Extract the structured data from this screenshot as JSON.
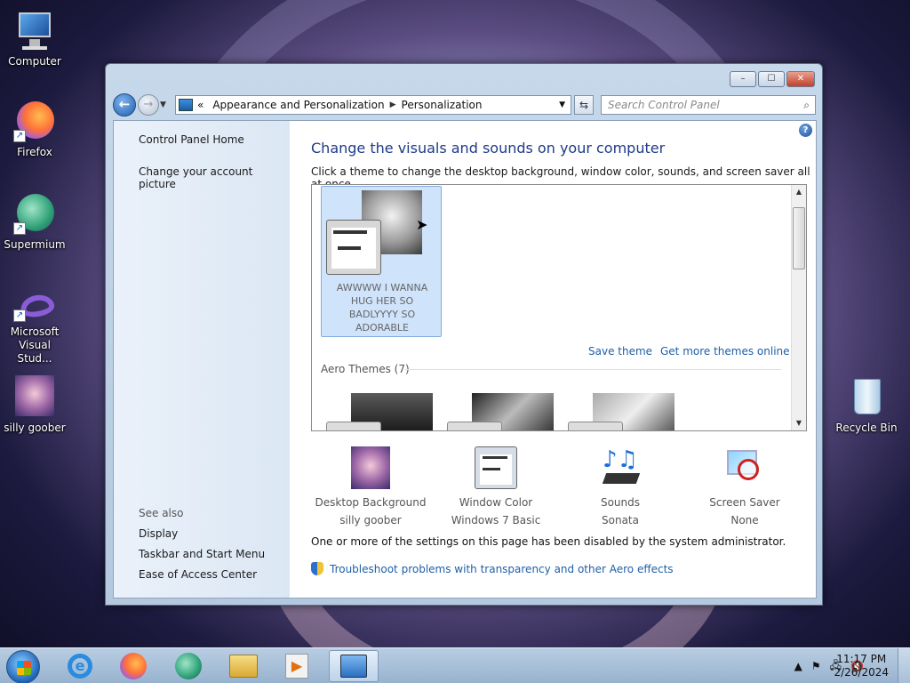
{
  "desktop": {
    "icons": [
      {
        "label": "Computer",
        "icon": "computer-icon"
      },
      {
        "label": "Firefox",
        "icon": "firefox-icon"
      },
      {
        "label": "Supermium",
        "icon": "supermium-icon"
      },
      {
        "label": "Microsoft Visual Stud...",
        "icon": "visual-studio-icon"
      },
      {
        "label": "silly goober",
        "icon": "image-file-icon"
      },
      {
        "label": "Recycle Bin",
        "icon": "recycle-bin-icon"
      }
    ]
  },
  "window": {
    "controls": {
      "minimize": "–",
      "maximize": "☐",
      "close": "✕"
    },
    "address": {
      "prefix": "«",
      "crumbs": [
        "Appearance and Personalization",
        "Personalization"
      ]
    },
    "search_placeholder": "Search Control Panel",
    "help_glyph": "?"
  },
  "sidebar": {
    "links": [
      "Control Panel Home",
      "Change your account picture"
    ],
    "see_also_label": "See also",
    "see_also": [
      "Display",
      "Taskbar and Start Menu",
      "Ease of Access Center"
    ]
  },
  "main": {
    "title": "Change the visuals and sounds on your computer",
    "subtitle": "Click a theme to change the desktop background, window color, sounds, and screen saver all at once.",
    "selected_theme_name": "AWWWW I WANNA HUG HER SO BADLYYYY SO ADORABLE",
    "save_theme": "Save theme",
    "get_more": "Get more themes online",
    "aero_label": "Aero Themes (7)",
    "settings": [
      {
        "label": "Desktop Background",
        "value": "silly goober"
      },
      {
        "label": "Window Color",
        "value": "Windows 7 Basic"
      },
      {
        "label": "Sounds",
        "value": "Sonata"
      },
      {
        "label": "Screen Saver",
        "value": "None"
      }
    ],
    "disabled_message": "One or more of the settings on this page has been disabled by the system administrator.",
    "troubleshoot": "Troubleshoot problems with transparency and other Aero effects"
  },
  "taskbar": {
    "pinned": [
      "internet-explorer-icon",
      "firefox-icon",
      "supermium-icon",
      "windows-explorer-icon",
      "media-player-icon",
      "control-panel-icon"
    ],
    "clock_time": "11:17 PM",
    "clock_date": "2/26/2024"
  }
}
